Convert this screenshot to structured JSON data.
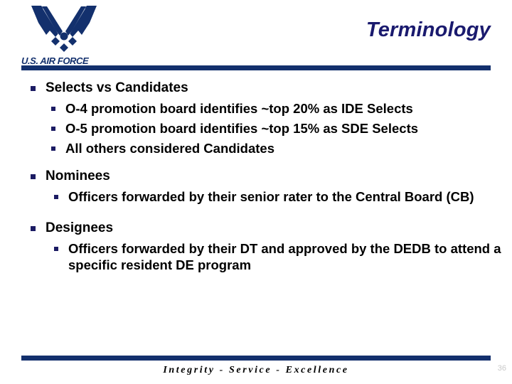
{
  "header": {
    "logo_icon": "air-force-wings-logo",
    "wordmark": "U.S. AIR FORCE",
    "title": "Terminology"
  },
  "colors": {
    "navy_bar": "#13306d",
    "title_navy": "#1a1a6e",
    "bullet_navy": "#1b1b63",
    "body_text": "#000000",
    "page_number": "#c9c9c9"
  },
  "content": {
    "groups": [
      {
        "heading": "Selects vs Candidates",
        "indent_style": "normal",
        "sub_items": [
          "O-4 promotion board identifies ~top 20% as IDE Selects",
          "O-5 promotion board identifies ~top 15% as SDE Selects",
          "All others considered Candidates"
        ]
      },
      {
        "heading": "Nominees",
        "indent_style": "deep",
        "sub_items": [
          "Officers forwarded by their senior rater to the Central Board (CB)"
        ]
      },
      {
        "heading": "Designees",
        "indent_style": "deep",
        "sub_items": [
          "Officers forwarded by their DT and approved by the DEDB to attend a specific resident DE program"
        ]
      }
    ]
  },
  "footer": {
    "motto": "Integrity - Service - Excellence",
    "page_number": "36"
  }
}
